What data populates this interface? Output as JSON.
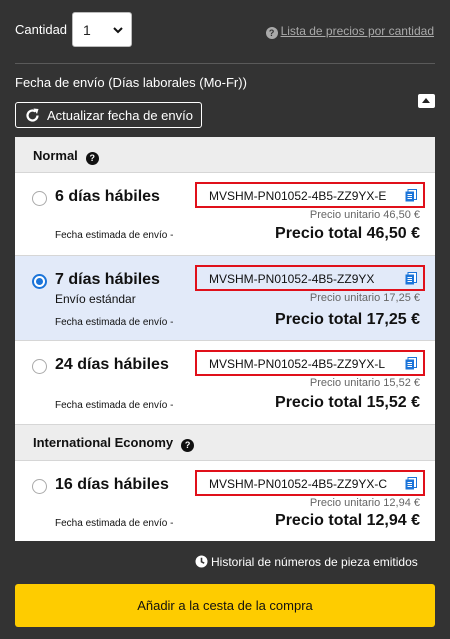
{
  "quantity": {
    "label": "Cantidad",
    "selected": "1",
    "price_list_link": "Lista de precios por cantidad"
  },
  "shipping": {
    "label": "Fecha de envío (Días laborales (Mo-Fr))",
    "update_button": "Actualizar fecha de envío"
  },
  "groups": [
    {
      "name": "Normal"
    },
    {
      "name": "International Economy"
    }
  ],
  "options": [
    {
      "days": "6 días hábiles",
      "standard_label": "",
      "part_number": "MVSHM-PN01052-4B5-ZZ9YX-E",
      "unit_price": "Precio unitario 46,50 €",
      "estimated_ship": "Fecha estimada de envío -",
      "total": "Precio total 46,50 €",
      "selected": false
    },
    {
      "days": "7 días hábiles",
      "standard_label": "Envío estándar",
      "part_number": "MVSHM-PN01052-4B5-ZZ9YX",
      "unit_price": "Precio unitario 17,25 €",
      "estimated_ship": "Fecha estimada de envío -",
      "total": "Precio total 17,25 €",
      "selected": true
    },
    {
      "days": "24 días hábiles",
      "standard_label": "",
      "part_number": "MVSHM-PN01052-4B5-ZZ9YX-L",
      "unit_price": "Precio unitario 15,52 €",
      "estimated_ship": "Fecha estimada de envío -",
      "total": "Precio total 15,52 €",
      "selected": false
    },
    {
      "days": "16 días hábiles",
      "standard_label": "",
      "part_number": "MVSHM-PN01052-4B5-ZZ9YX-C",
      "unit_price": "Precio unitario 12,94 €",
      "estimated_ship": "Fecha estimada de envío -",
      "total": "Precio total 12,94 €",
      "selected": false
    }
  ],
  "history_link": "Historial de números de pieza emitidos",
  "add_to_cart": "Añadir a la cesta de la compra",
  "colors": {
    "background": "#333333",
    "selected_row": "#e2eaf9",
    "highlight_border": "#e0101a",
    "radio_blue": "#1b74d9",
    "add_button": "#fecc00",
    "copy_icon": "#1b74d9"
  }
}
